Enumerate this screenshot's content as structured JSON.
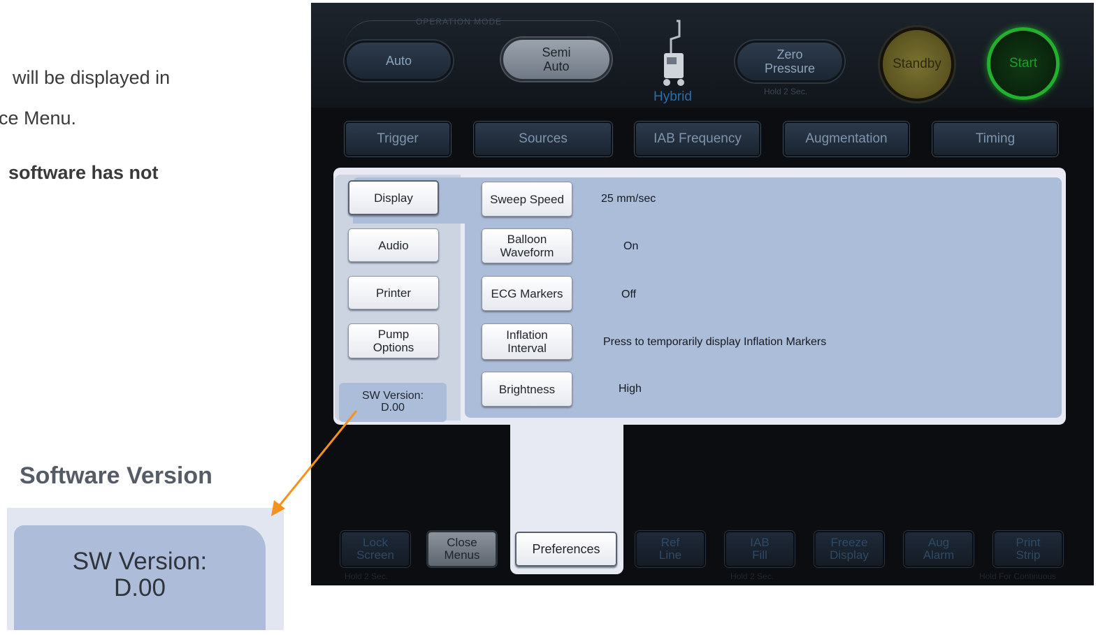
{
  "slide": {
    "line1": "will be displayed in",
    "line2": "ce Menu.",
    "line3": "software has not",
    "zoom_title": "Software Version",
    "zoom_sw_line1": "SW Version:",
    "zoom_sw_line2": "D.00",
    "arrow_color": "#f5921e"
  },
  "header": {
    "operation_mode_label": "OPERATION MODE",
    "auto": "Auto",
    "semi_auto_line1": "Semi",
    "semi_auto_line2": "Auto",
    "hybrid": "Hybrid",
    "zero_pressure_line1": "Zero",
    "zero_pressure_line2": "Pressure",
    "zero_hold": "Hold 2 Sec.",
    "standby": "Standby",
    "start": "Start"
  },
  "tabs": [
    "Trigger",
    "Sources",
    "IAB Frequency",
    "Augmentation",
    "Timing"
  ],
  "side_menu": {
    "display": "Display",
    "audio": "Audio",
    "printer": "Printer",
    "pump_line1": "Pump",
    "pump_line2": "Options",
    "sw_line1": "SW Version:",
    "sw_line2": "D.00"
  },
  "settings": [
    {
      "label1": "Sweep Speed",
      "label2": "",
      "value": "25 mm/sec"
    },
    {
      "label1": "Balloon",
      "label2": "Waveform",
      "value": "On"
    },
    {
      "label1": "ECG Markers",
      "label2": "",
      "value": "Off"
    },
    {
      "label1": "Inflation",
      "label2": "Interval",
      "value": "Press to temporarily display Inflation Markers"
    },
    {
      "label1": "Brightness",
      "label2": "",
      "value": "High"
    }
  ],
  "bottom": {
    "lock_line1": "Lock",
    "lock_line2": "Screen",
    "lock_hold": "Hold 2 Sec.",
    "close_line1": "Close",
    "close_line2": "Menus",
    "preferences": "Preferences",
    "ref_line1": "Ref",
    "ref_line2": "Line",
    "iab_line1": "IAB",
    "iab_line2": "Fill",
    "iab_hold": "Hold 2 Sec.",
    "freeze_line1": "Freeze",
    "freeze_line2": "Display",
    "aug_line1": "Aug",
    "aug_line2": "Alarm",
    "print_line1": "Print",
    "print_line2": "Strip",
    "print_hold": "Hold For Continuous"
  },
  "colors": {
    "standby": "#6b6329",
    "start_ring": "#22b02e",
    "panel_blue": "#acbdd9"
  }
}
